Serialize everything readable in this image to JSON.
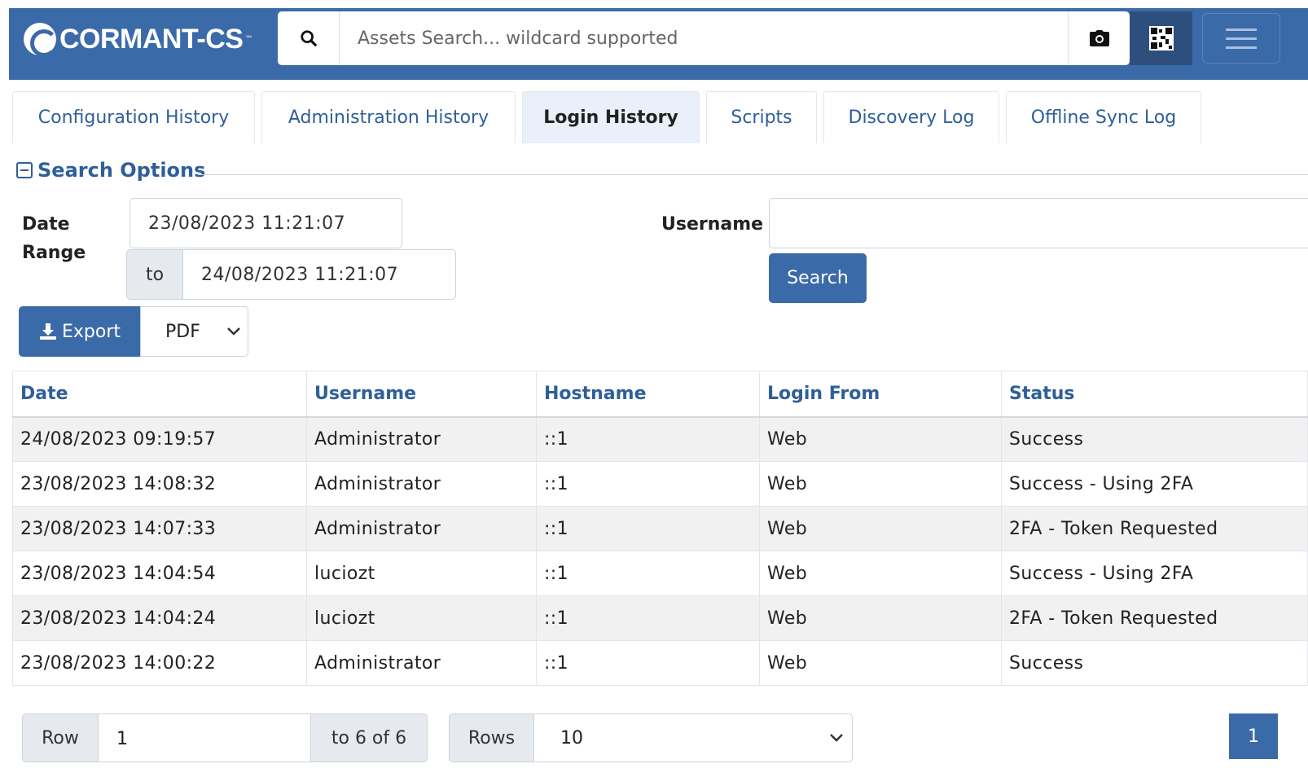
{
  "header": {
    "logo_text": "CORMANT-CS",
    "logo_tm": "™",
    "search_placeholder": "Assets Search... wildcard supported"
  },
  "tabs": [
    {
      "label": "Configuration History",
      "active": false
    },
    {
      "label": "Administration History",
      "active": false
    },
    {
      "label": "Login History",
      "active": true
    },
    {
      "label": "Scripts",
      "active": false
    },
    {
      "label": "Discovery Log",
      "active": false
    },
    {
      "label": "Offline Sync Log",
      "active": false
    }
  ],
  "search_options": {
    "legend": "Search Options",
    "date_range_label_1": "Date",
    "date_range_label_2": "Range",
    "date_from": "23/08/2023 11:21:07",
    "to_label": "to",
    "date_to": "24/08/2023 11:21:07",
    "username_label": "Username",
    "username_value": "",
    "search_button": "Search"
  },
  "export": {
    "button_label": "Export",
    "format_selected": "PDF"
  },
  "table": {
    "columns": [
      "Date",
      "Username",
      "Hostname",
      "Login From",
      "Status"
    ],
    "rows": [
      [
        "24/08/2023 09:19:57",
        "Administrator",
        "::1",
        "Web",
        "Success"
      ],
      [
        "23/08/2023 14:08:32",
        "Administrator",
        "::1",
        "Web",
        "Success - Using 2FA"
      ],
      [
        "23/08/2023 14:07:33",
        "Administrator",
        "::1",
        "Web",
        "2FA - Token Requested"
      ],
      [
        "23/08/2023 14:04:54",
        "luciozt",
        "::1",
        "Web",
        "Success - Using 2FA"
      ],
      [
        "23/08/2023 14:04:24",
        "luciozt",
        "::1",
        "Web",
        "2FA - Token Requested"
      ],
      [
        "23/08/2023 14:00:22",
        "Administrator",
        "::1",
        "Web",
        "Success"
      ]
    ]
  },
  "pagination": {
    "row_label": "Row",
    "row_value": "1",
    "range_text": "to 6 of 6",
    "rows_label": "Rows",
    "rows_per_page": "10",
    "current_page": "1"
  },
  "colors": {
    "brand": "#3b6aa8",
    "link": "#2f5f9a"
  }
}
